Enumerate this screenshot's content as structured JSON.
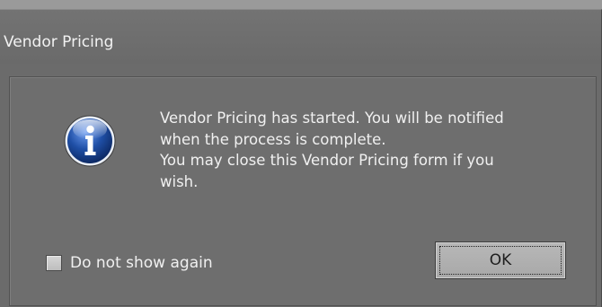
{
  "window": {
    "title": "Vendor Pricing"
  },
  "dialog": {
    "icon": "info-icon",
    "message_lines": [
      "Vendor Pricing has started. You will be notified",
      "when the process is complete.",
      "You may close this Vendor Pricing form if you",
      "wish."
    ],
    "checkbox": {
      "label": "Do not show again",
      "checked": false
    },
    "ok_button_label": "OK"
  },
  "colors": {
    "window_bg": "#6b6b6b",
    "text": "#f0f0f0",
    "button_bg": "#b0b0b0",
    "icon_blue": "#1f4fa6"
  }
}
